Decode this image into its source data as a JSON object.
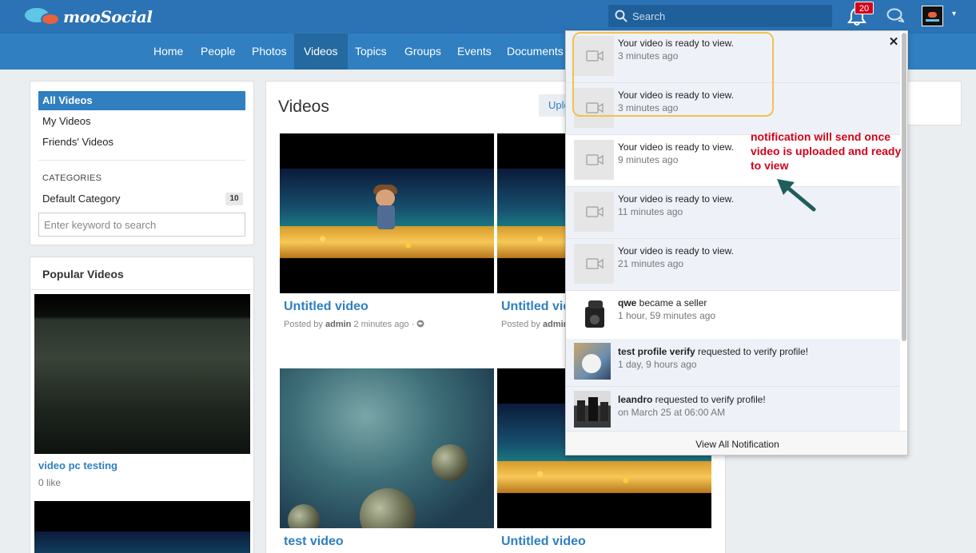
{
  "app": {
    "logo_text": "mooSocial"
  },
  "header": {
    "search_placeholder": "Search",
    "notification_count": "20"
  },
  "nav": {
    "items": [
      {
        "label": "Home"
      },
      {
        "label": "People"
      },
      {
        "label": "Photos"
      },
      {
        "label": "Videos"
      },
      {
        "label": "Topics"
      },
      {
        "label": "Groups"
      },
      {
        "label": "Events"
      },
      {
        "label": "Documents"
      }
    ],
    "active": "Videos"
  },
  "sidebar": {
    "menu": [
      {
        "label": "All Videos"
      },
      {
        "label": "My Videos"
      },
      {
        "label": "Friends' Videos"
      }
    ],
    "categories_title": "CATEGORIES",
    "category": {
      "label": "Default Category",
      "count": "10"
    },
    "keyword_placeholder": "Enter keyword to search",
    "popular_title": "Popular Videos",
    "popular": [
      {
        "title": "video pc testing",
        "likes": "0 like"
      }
    ]
  },
  "main": {
    "title": "Videos",
    "upload_label": "Uplo",
    "videos": [
      {
        "title": "Untitled video",
        "posted_prefix": "Posted by",
        "author": "admin",
        "time": "2 minutes ago ·"
      },
      {
        "title": "Untitled vid",
        "posted_prefix": "Posted by",
        "author": "admin"
      },
      {
        "title": "test video"
      },
      {
        "title": "Untitled video"
      }
    ]
  },
  "notifications": {
    "items": [
      {
        "actor": "",
        "text": "Your video is ready to view.",
        "time": "3 minutes ago",
        "icon": "video-camera-icon"
      },
      {
        "actor": "",
        "text": "Your video is ready to view.",
        "time": "3 minutes ago",
        "icon": "video-camera-icon"
      },
      {
        "actor": "",
        "text": "Your video is ready to view.",
        "time": "9 minutes ago",
        "icon": "video-camera-icon"
      },
      {
        "actor": "",
        "text": "Your video is ready to view.",
        "time": "11 minutes ago",
        "icon": "video-camera-icon"
      },
      {
        "actor": "",
        "text": "Your video is ready to view.",
        "time": "21 minutes ago",
        "icon": "video-camera-icon"
      },
      {
        "actor": "qwe",
        "text": " became a seller",
        "time": "1 hour, 59 minutes ago",
        "icon": "user-avatar"
      },
      {
        "actor": "test profile verify",
        "text": " requested to verify profile!",
        "time": "1 day, 9 hours ago",
        "icon": "user-avatar"
      },
      {
        "actor": "leandro",
        "text": " requested to verify profile!",
        "time": "on March 25 at 06:00 AM",
        "icon": "user-avatar"
      }
    ],
    "view_all": "View All Notification"
  },
  "annotation": {
    "text": "notification will send once video is uploaded and ready to view",
    "color": "#d0021b",
    "highlight_color": "#f2c14e"
  },
  "colors": {
    "topbar": "#2b73b5",
    "navbar": "#2f7fc1",
    "accent": "#2f7fc1"
  }
}
